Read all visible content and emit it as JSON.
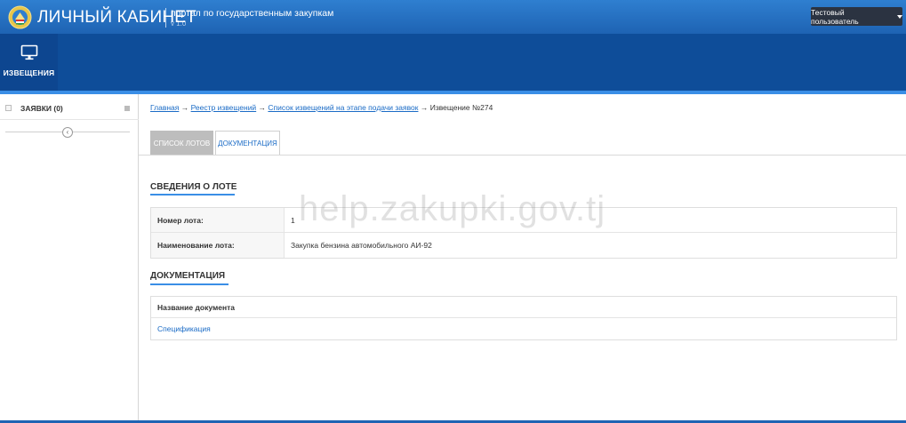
{
  "header": {
    "brand": "ЛИЧНЫЙ КАБИНЕТ",
    "portal": "портал по государственным закупкам",
    "version": "v 1.0",
    "user_button": "Тестовый пользователь"
  },
  "nav": {
    "items": [
      {
        "label": "ИЗВЕЩЕНИЯ",
        "icon": "monitor-icon"
      }
    ]
  },
  "sidebar": {
    "title": "ЗАЯВКИ (0)",
    "collapse_glyph": "‹"
  },
  "breadcrumb": {
    "items": [
      "Главная",
      "Реестр извещений",
      "Список извещений на этапе подачи заявок"
    ],
    "separator": " → ",
    "current": "Извещение №274"
  },
  "tabs": [
    {
      "label": "СПИСОК ЛОТОВ",
      "active": false
    },
    {
      "label": "ДОКУМЕНТАЦИЯ",
      "active": true
    }
  ],
  "lot": {
    "title": "СВЕДЕНИЯ О ЛОТЕ",
    "rows": [
      {
        "key": "Номер лота:",
        "value": "1"
      },
      {
        "key": "Наименование лота:",
        "value": "Закупка бензина автомобильного АИ-92"
      }
    ]
  },
  "docs": {
    "title": "ДОКУМЕНТАЦИЯ",
    "column_header": "Название документа",
    "items": [
      "Спецификация"
    ]
  },
  "watermark": "help.zakupki.gov.tj",
  "colors": {
    "header_blue": "#1e63b3",
    "nav_blue": "#0e4d99",
    "accent": "#3a8ee6",
    "link": "#1a6bc6"
  }
}
